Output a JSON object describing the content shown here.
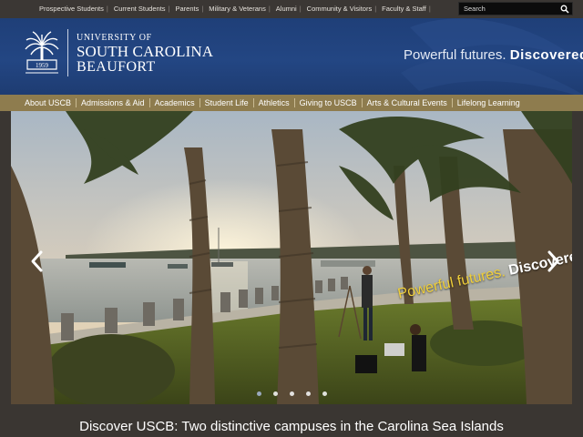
{
  "utility_nav": {
    "items": [
      {
        "label": "Prospective Students"
      },
      {
        "label": "Current Students"
      },
      {
        "label": "Parents"
      },
      {
        "label": "Military & Veterans"
      },
      {
        "label": "Alumni"
      },
      {
        "label": "Community & Visitors"
      },
      {
        "label": "Faculty & Staff"
      }
    ],
    "search_placeholder": "Search",
    "search_icon": "magnifier"
  },
  "header": {
    "logo_line1": "UNIVERSITY OF",
    "logo_line2": "SOUTH CAROLINA",
    "logo_line3": "BEAUFORT",
    "tagline_light": "Powerful futures.",
    "tagline_bold": "Discovered.",
    "logo_icon": "palmetto-seal-icon"
  },
  "main_nav": {
    "items": [
      {
        "label": "About USCB"
      },
      {
        "label": "Admissions & Aid"
      },
      {
        "label": "Academics"
      },
      {
        "label": "Student Life"
      },
      {
        "label": "Athletics"
      },
      {
        "label": "Giving to USCB"
      },
      {
        "label": "Arts & Cultural Events"
      },
      {
        "label": "Lifelong Learning"
      }
    ]
  },
  "hero": {
    "overlay_light": "Powerful futures.",
    "overlay_bold": "Discovered.",
    "slide_count": 5,
    "active_slide": 1,
    "caption": "Discover USCB: Two distinctive campuses in the Carolina Sea Islands"
  },
  "colors": {
    "utility_bg": "#3b3734",
    "header_blue": "#234683",
    "nav_gold": "#8e7c4e",
    "tagline_yellow": "#f0cf3a"
  }
}
